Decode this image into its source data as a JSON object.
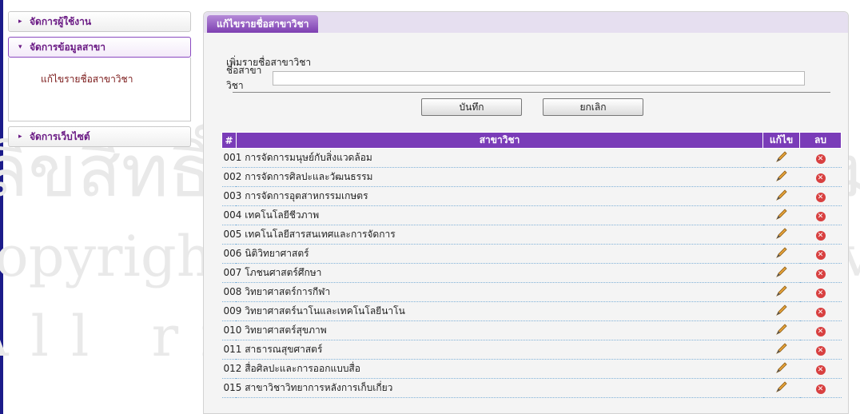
{
  "sidebar": {
    "sections": [
      {
        "label": "จัดการผู้ใช้งาน"
      },
      {
        "label": "จัดการข้อมูลสาขา",
        "items": [
          {
            "label": "แก้ไขรายชื่อสาขาวิชา"
          }
        ]
      },
      {
        "label": "จัดการเว็บไซต์"
      }
    ]
  },
  "panel": {
    "tab": "แก้ไขรายชื่อสาขาวิชา",
    "form": {
      "title": "เพิ่มรายชื่อสาขาวิชา",
      "field_label": "ชื่อสาขาวิชา",
      "field_value": "",
      "save_label": "บันทึก",
      "cancel_label": "ยกเลิก"
    },
    "table": {
      "headers": [
        "#",
        "สาขาวิชา",
        "แก้ไข",
        "ลบ"
      ],
      "edit_icon": "pencil-icon",
      "delete_icon": "delete-icon",
      "rows": [
        {
          "code": "001",
          "name": "การจัดการมนุษย์กับสิ่งแวดล้อม"
        },
        {
          "code": "002",
          "name": "การจัดการศิลปะและวัฒนธรรม"
        },
        {
          "code": "003",
          "name": "การจัดการอุตสาหกรรมเกษตร"
        },
        {
          "code": "004",
          "name": "เทคโนโลยีชีวภาพ"
        },
        {
          "code": "005",
          "name": "เทคโนโลยีสารสนเทศและการจัดการ"
        },
        {
          "code": "006",
          "name": "นิติวิทยาศาสตร์"
        },
        {
          "code": "007",
          "name": "โภชนศาสตร์ศึกษา"
        },
        {
          "code": "008",
          "name": "วิทยาศาสตร์การกีฬา"
        },
        {
          "code": "009",
          "name": "วิทยาศาสตร์นาโนและเทคโนโลยีนาโน"
        },
        {
          "code": "010",
          "name": "วิทยาศาสตร์สุขภาพ"
        },
        {
          "code": "011",
          "name": "สาธารณสุขศาสตร์"
        },
        {
          "code": "012",
          "name": "สื่อศิลปะและการออกแบบสื่อ"
        },
        {
          "code": "015",
          "name": "สาขาวิชาวิทยาการหลังการเก็บเกี่ยว"
        }
      ]
    }
  },
  "colors": {
    "accent": "#7a3cb8",
    "sidebar_text": "#6a1a84",
    "link": "#7a1818",
    "delete": "#d84040"
  }
}
